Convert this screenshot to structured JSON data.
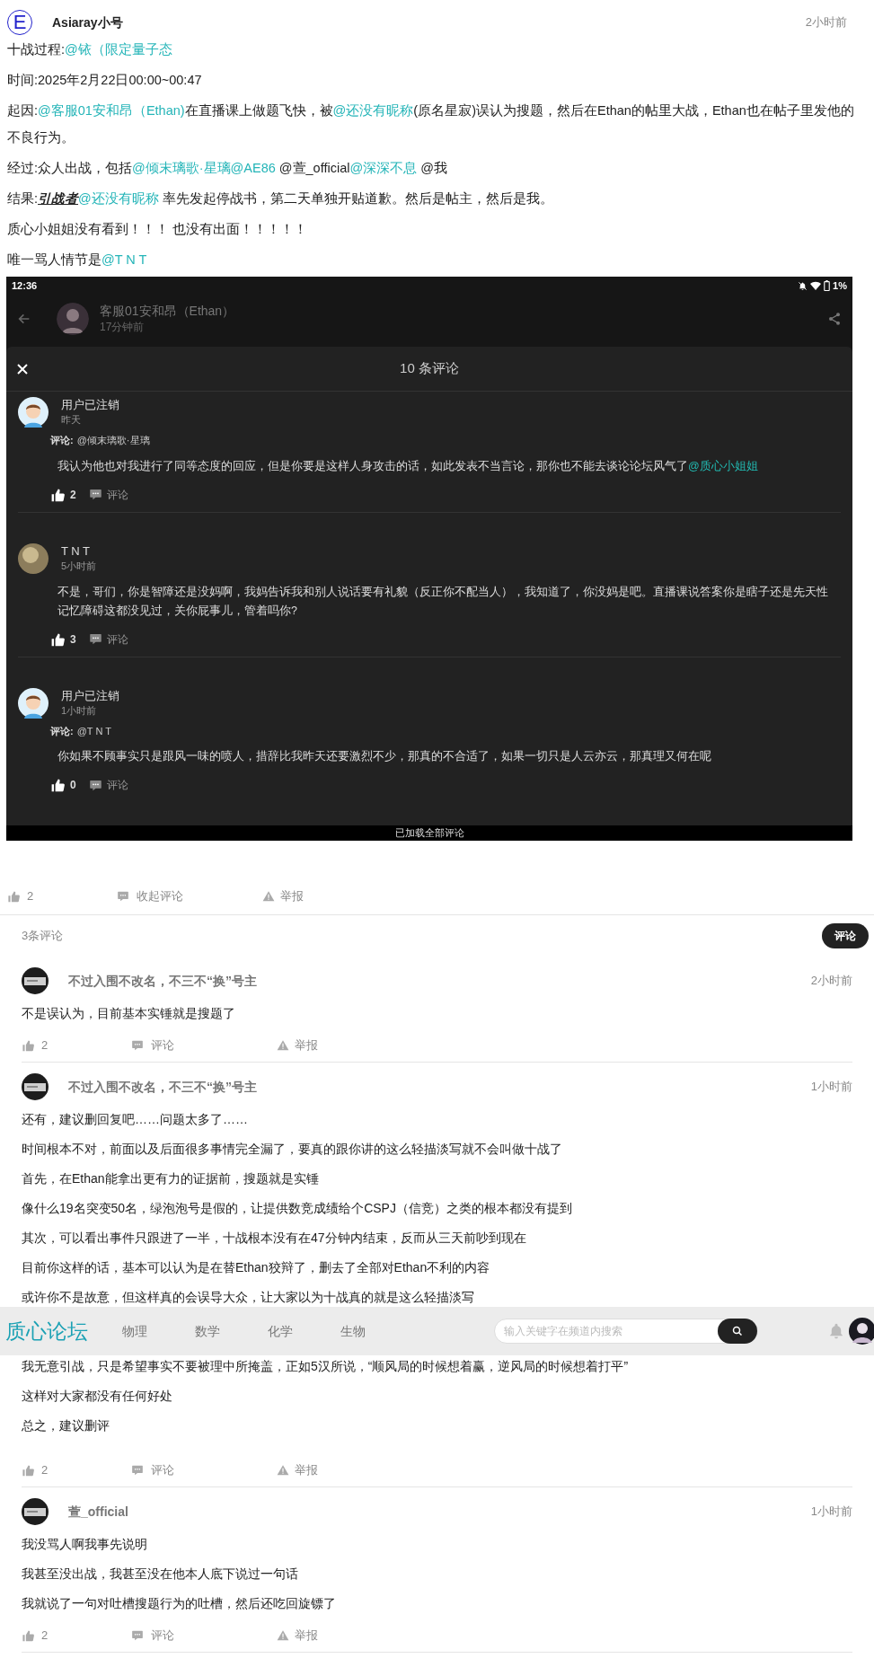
{
  "post": {
    "avatar_letter": "E",
    "author": "Asiaray小号",
    "time": "2小时前",
    "paragraphs": [
      [
        {
          "kind": "plain",
          "text": "十战过程:"
        },
        {
          "kind": "mention",
          "text": "@铱（限定量子态"
        }
      ],
      [
        {
          "kind": "plain",
          "text": "时间:2025年2月22日00:00~00:47"
        }
      ],
      [
        {
          "kind": "plain",
          "text": "起因:"
        },
        {
          "kind": "mention",
          "text": "@客服01安和昂（Ethan)"
        },
        {
          "kind": "plain",
          "text": "在直播课上做题飞快，被"
        },
        {
          "kind": "mention",
          "text": "@还没有昵称"
        },
        {
          "kind": "plain",
          "text": "(原名星寂)误认为搜题，然后在Ethan的帖里大战，Ethan也在帖子里发他的不良行为。"
        }
      ],
      [
        {
          "kind": "plain",
          "text": "经过:众人出战，包括"
        },
        {
          "kind": "mention",
          "text": "@倾末璃歌·星璃"
        },
        {
          "kind": "mention",
          "text": "@AE86"
        },
        {
          "kind": "plain",
          "text": " @萱_official"
        },
        {
          "kind": "mention",
          "text": "@深深不息"
        },
        {
          "kind": "plain",
          "text": " @我"
        }
      ],
      [
        {
          "kind": "plain",
          "text": "结果:"
        },
        {
          "kind": "emphasis",
          "text": "引战者"
        },
        {
          "kind": "mention",
          "text": "@还没有昵称"
        },
        {
          "kind": "plain",
          "text": " 率先发起停战书，第二天单独开贴道歉。然后是帖主，然后是我。"
        }
      ],
      [
        {
          "kind": "plain",
          "text": "质心小姐姐没有看到！！！ 也没有出面！！！！！"
        }
      ],
      [
        {
          "kind": "plain",
          "text": "唯一骂人情节是"
        },
        {
          "kind": "mention",
          "text": "@T N T"
        }
      ]
    ],
    "screenshot": {
      "clock": "12:36",
      "battery": "1%",
      "author": "客服01安和昂（Ethan）",
      "author_time": "17分钟前",
      "sheet_title": "10 条评论",
      "footer": "已加载全部评论",
      "comments": [
        {
          "kind": "cartoon",
          "name": "用户已注销",
          "time": "昨天",
          "reply_label": "评论:",
          "reply_to": "@倾末璃歌·星璃",
          "segments": [
            {
              "kind": "plain",
              "text": "我认为他也对我进行了同等态度的回应，但是你要是这样人身攻击的话，如此发表不当言论，那你也不能去谈论论坛风气了"
            },
            {
              "kind": "mention",
              "text": "@质心小姐姐"
            }
          ],
          "likes": "2",
          "comment_label": "评论"
        },
        {
          "kind": "ball",
          "name": "T N T",
          "time": "5小时前",
          "segments": [
            {
              "kind": "plain",
              "text": "不是，哥们，你是智障还是没妈啊，我妈告诉我和别人说话要有礼貌（反正你不配当人），我知道了，你没妈是吧。直播课说答案你是瞎子还是先天性记忆障碍这都没见过，关你屁事儿，管着吗你?"
            }
          ],
          "likes": "3",
          "comment_label": "评论"
        },
        {
          "kind": "cartoon",
          "name": "用户已注销",
          "time": "1小时前",
          "reply_label": "评论:",
          "reply_to": "@T N T",
          "segments": [
            {
              "kind": "plain",
              "text": "你如果不顾事实只是跟风一味的喷人，措辞比我昨天还要激烈不少，那真的不合适了，如果一切只是人云亦云，那真理又何在呢"
            }
          ],
          "likes": "0",
          "comment_label": "评论"
        }
      ]
    },
    "likes": "2",
    "collapse_label": "收起评论",
    "report_label": "举报"
  },
  "comments_section": {
    "count": "3条评论",
    "comment_button": "评论",
    "comments": [
      {
        "name": "不过入围不改名，不三不“换”号主",
        "time": "2小时前",
        "paragraphs": [
          "不是误认为，目前基本实锤就是搜题了"
        ],
        "likes": "2",
        "comment_label": "评论",
        "report_label": "举报"
      },
      {
        "name": "不过入围不改名，不三不“换”号主",
        "time": "1小时前",
        "paragraphs": [
          "还有，建议删回复吧……问题太多了……",
          "时间根本不对，前面以及后面很多事情完全漏了，要真的跟你讲的这么轻描淡写就不会叫做十战了",
          "首先，在Ethan能拿出更有力的证据前，搜题就是实锤",
          "像什么19名突变50名，绿泡泡号是假的，让提供数竞成绩给个CSPJ（信竞）之类的根本都没有提到",
          "其次，可以看出事件只跟进了一半，十战根本没有在47分钟内结束，反而从三天前吵到现在",
          "目前你这样的话，基本可以认为是在替Ethan狡辩了，删去了全部对Ethan不利的内容",
          "或许你不是故意，但这样真的会误导大众，让大家以为十战真的就是这么轻描淡写",
          "我无意引战，只是希望事实不要被理中所掩盖，正如5汉所说，“顺风局的时候想着赢，逆风局的时候想着打平”",
          "这样对大家都没有任何好处",
          "总之，建议删评"
        ],
        "likes": "2",
        "comment_label": "评论",
        "report_label": "举报"
      },
      {
        "name": "萱_official",
        "time": "1小时前",
        "paragraphs": [
          "我没骂人啊我事先说明",
          "我甚至没出战，我甚至没在他本人底下说过一句话",
          "我就说了一句对吐槽搜题行为的吐槽，然后还吃回旋镖了"
        ],
        "likes": "2",
        "comment_label": "评论",
        "report_label": "举报"
      }
    ]
  },
  "nav_bar": {
    "logo": "质心论坛",
    "tabs": [
      "物理",
      "数学",
      "化学",
      "生物"
    ],
    "search_placeholder": "输入关键字在频道内搜索"
  }
}
